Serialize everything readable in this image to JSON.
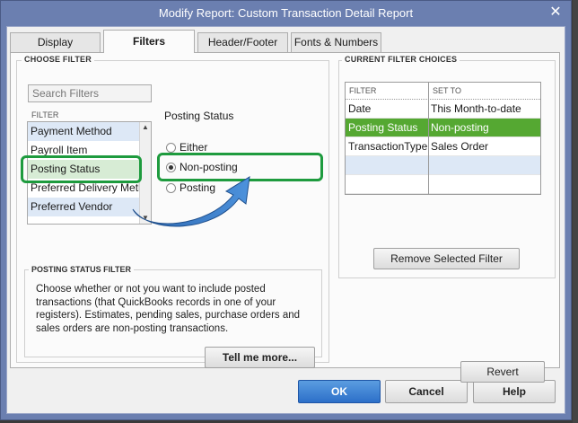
{
  "window": {
    "title": "Modify Report: Custom Transaction Detail Report",
    "close_glyph": "✕"
  },
  "tabs": [
    {
      "label": "Display",
      "active": false
    },
    {
      "label": "Filters",
      "active": true
    },
    {
      "label": "Header/Footer",
      "active": false
    },
    {
      "label": "Fonts & Numbers",
      "active": false
    }
  ],
  "choose_filter": {
    "group_label": "CHOOSE FILTER",
    "search_placeholder": "Search Filters",
    "list_header": "FILTER",
    "items": [
      "Payment Method",
      "Payroll Item",
      "Posting Status",
      "Preferred Delivery Meth",
      "Preferred Vendor"
    ],
    "selected_item": "Posting Status",
    "field_title": "Posting Status",
    "options": [
      "Either",
      "Non-posting",
      "Posting"
    ],
    "selected_option": "Non-posting"
  },
  "posting_filter": {
    "group_label": "POSTING STATUS FILTER",
    "description": "Choose whether or not you want to include posted transactions (that QuickBooks records in one of your registers). Estimates, pending sales, purchase orders and sales orders are non-posting transactions.",
    "tell_me_more": "Tell me more..."
  },
  "current_filters": {
    "group_label": "CURRENT FILTER CHOICES",
    "col_filter": "FILTER",
    "col_set_to": "SET TO",
    "rows": [
      {
        "filter": "Date",
        "set_to": "This Month-to-date"
      },
      {
        "filter": "Posting Status",
        "set_to": "Non-posting"
      },
      {
        "filter": "TransactionType",
        "set_to": "Sales Order"
      }
    ],
    "remove_button": "Remove Selected Filter"
  },
  "buttons": {
    "revert": "Revert",
    "ok": "OK",
    "cancel": "Cancel",
    "help": "Help"
  },
  "colors": {
    "highlight": "#1e9b3e",
    "selected_row": "#55a832",
    "arrow": "#2f74c0",
    "title_bar": "#6b7fb0"
  }
}
